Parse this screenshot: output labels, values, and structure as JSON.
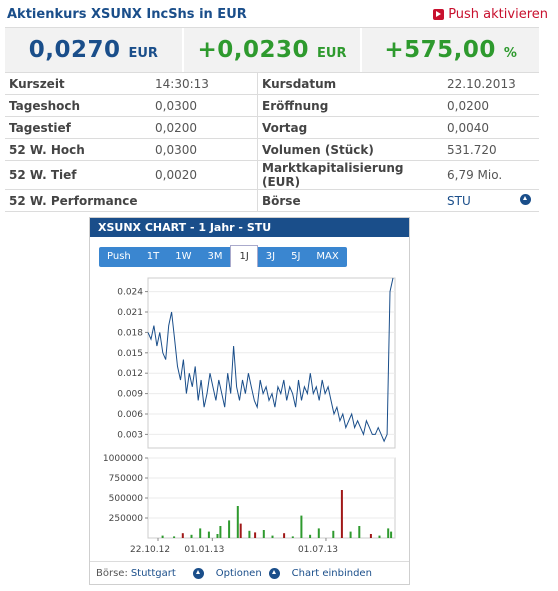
{
  "header": {
    "title": "Aktienkurs XSUNX IncShs in EUR",
    "push_label": "Push aktivieren"
  },
  "quote": {
    "price": "0,0270",
    "price_unit": "EUR",
    "change": "+0,0230",
    "change_unit": "EUR",
    "change_pct": "+575,00",
    "change_pct_unit": "%"
  },
  "stats": [
    {
      "l1": "Kurszeit",
      "v1": "14:30:13",
      "l2": "Kursdatum",
      "v2": "22.10.2013"
    },
    {
      "l1": "Tageshoch",
      "v1": "0,0300",
      "l2": "Eröffnung",
      "v2": "0,0200"
    },
    {
      "l1": "Tagestief",
      "v1": "0,0200",
      "l2": "Vortag",
      "v2": "0,0040"
    },
    {
      "l1": "52 W. Hoch",
      "v1": "0,0300",
      "l2": "Volumen (Stück)",
      "v2": "531.720"
    },
    {
      "l1": "52 W. Tief",
      "v1": "0,0020",
      "l2": "Marktkapitalisierung (EUR)",
      "v2": "6,79 Mio."
    },
    {
      "l1": "52 W. Performance",
      "v1": "",
      "l2": "Börse",
      "v2": "STU"
    }
  ],
  "chart": {
    "header": "XSUNX CHART - 1 Jahr - STU",
    "tabs": [
      "Push",
      "1T",
      "1W",
      "3M",
      "1J",
      "3J",
      "5J",
      "MAX"
    ],
    "active_tab": "1J",
    "footer": {
      "exchange_label": "Börse:",
      "exchange_value": "Stuttgart",
      "options": "Optionen",
      "embed": "Chart einbinden"
    }
  },
  "chart_data": [
    {
      "type": "line",
      "yticks": [
        "0.024",
        "0.021",
        "0.018",
        "0.015",
        "0.012",
        "0.009",
        "0.006",
        "0.003"
      ],
      "ylim": [
        0.001,
        0.026
      ],
      "x_labels": [
        "22.10.12",
        "01.01.13",
        "01.07.13"
      ],
      "y": [
        0.018,
        0.017,
        0.019,
        0.016,
        0.018,
        0.015,
        0.014,
        0.019,
        0.021,
        0.017,
        0.013,
        0.011,
        0.014,
        0.009,
        0.012,
        0.01,
        0.013,
        0.008,
        0.011,
        0.007,
        0.009,
        0.012,
        0.01,
        0.008,
        0.011,
        0.009,
        0.007,
        0.012,
        0.009,
        0.016,
        0.01,
        0.008,
        0.011,
        0.009,
        0.012,
        0.01,
        0.008,
        0.007,
        0.011,
        0.009,
        0.01,
        0.008,
        0.009,
        0.007,
        0.01,
        0.009,
        0.011,
        0.008,
        0.01,
        0.009,
        0.007,
        0.011,
        0.008,
        0.01,
        0.009,
        0.012,
        0.009,
        0.01,
        0.008,
        0.011,
        0.009,
        0.01,
        0.008,
        0.006,
        0.007,
        0.005,
        0.006,
        0.004,
        0.005,
        0.006,
        0.004,
        0.005,
        0.004,
        0.003,
        0.005,
        0.004,
        0.003,
        0.003,
        0.004,
        0.003,
        0.002,
        0.003,
        0.024,
        0.027
      ]
    },
    {
      "type": "bar",
      "yticks": [
        "1000000",
        "750000",
        "500000",
        "250000"
      ],
      "ylim": [
        0,
        1000000
      ],
      "values": [
        0,
        0,
        0,
        0,
        30000,
        0,
        0,
        0,
        20000,
        0,
        0,
        60000,
        0,
        0,
        40000,
        0,
        0,
        120000,
        0,
        0,
        80000,
        0,
        0,
        50000,
        150000,
        0,
        0,
        220000,
        0,
        0,
        400000,
        180000,
        0,
        0,
        90000,
        0,
        70000,
        0,
        0,
        100000,
        0,
        0,
        30000,
        0,
        0,
        0,
        60000,
        0,
        0,
        20000,
        0,
        0,
        280000,
        0,
        0,
        40000,
        0,
        0,
        120000,
        0,
        0,
        0,
        0,
        90000,
        0,
        0,
        600000,
        0,
        0,
        80000,
        0,
        0,
        150000,
        0,
        0,
        0,
        50000,
        0,
        0,
        30000,
        0,
        0,
        120000,
        80000
      ],
      "colors": [
        "#2e9a2e",
        "#a01818"
      ]
    }
  ]
}
